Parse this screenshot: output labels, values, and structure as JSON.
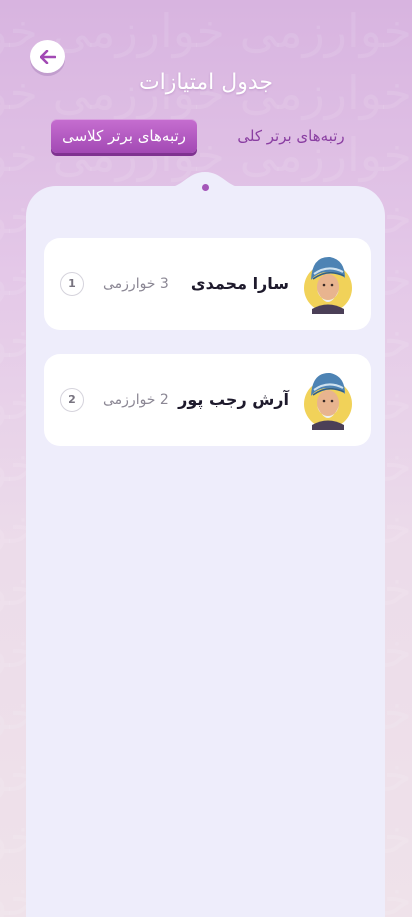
{
  "page": {
    "title": "جدول امتیازات",
    "back_icon": "arrow-left-icon",
    "accent": "#a249b4"
  },
  "tabs": [
    {
      "label": "رتبه‌های برتر کلاسی",
      "active": true
    },
    {
      "label": "رتبه‌های برتر کلی",
      "active": false
    }
  ],
  "leaderboard": [
    {
      "name": "سارا محمدی",
      "score": "3 خوارزمی",
      "rank": "1",
      "avatar": "scholar-avatar-icon"
    },
    {
      "name": "آرش رجب پور",
      "score": "2 خوارزمی",
      "rank": "2",
      "avatar": "scholar-avatar-icon"
    }
  ]
}
